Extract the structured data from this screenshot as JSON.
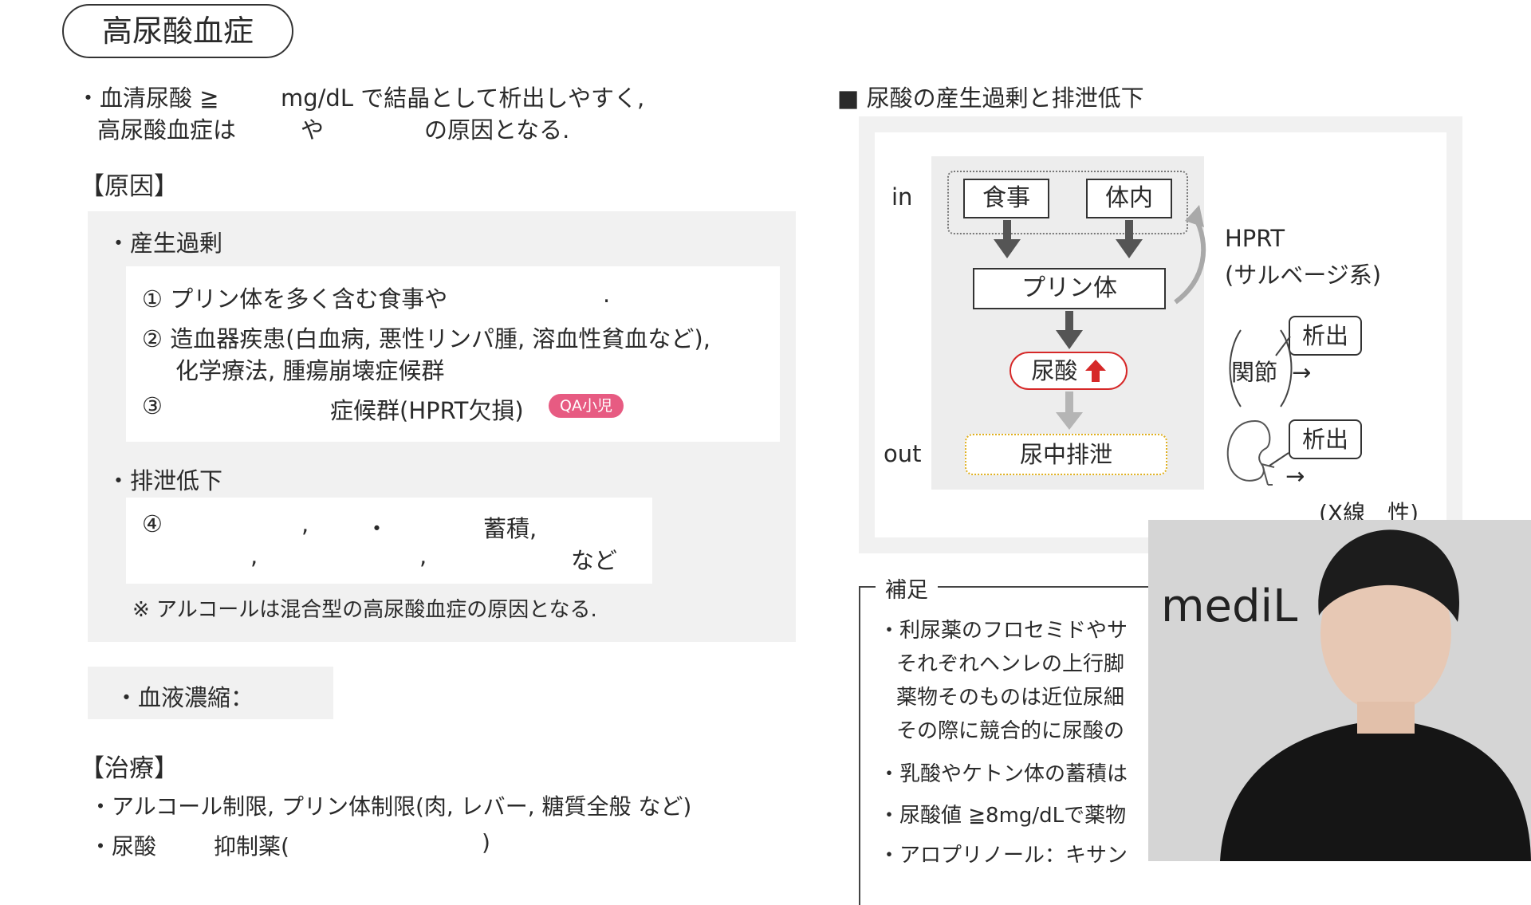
{
  "title": "高尿酸血症",
  "intro": {
    "line1": "・血清尿酸 ≧",
    "line1_unit": "mg/dL で結晶として析出しやすく,",
    "line2a": "高尿酸血症は",
    "line2b": "や",
    "line2c": "の原因となる."
  },
  "cause": {
    "heading": "【原因】",
    "overproduction": {
      "label": "・産生過剰",
      "item1": "① プリン体を多く含む食事や",
      "item1_end": ".",
      "item2_line1": "② 造血器疾患(白血病, 悪性リンパ腫, 溶血性貧血など),",
      "item2_line2": "化学療法, 腫瘍崩壊症候群",
      "item3_num": "③",
      "item3": "症候群(HPRT欠損)",
      "item3_badge": "QA小児"
    },
    "excretion": {
      "label": "・排泄低下",
      "item4_num": "④",
      "item4_c1": ",",
      "item4_dot": "・",
      "item4_acc": "蓄積,",
      "item4_c2": ",",
      "item4_c3": ",",
      "item4_etc": "など",
      "note": "※ アルコールは混合型の高尿酸血症の原因となる."
    },
    "concentration": "・血液濃縮："
  },
  "treatment": {
    "heading": "【治療】",
    "item1": "・アルコール制限, プリン体制限(肉, レバー, 糖質全般 など)",
    "item2a": "・尿酸",
    "item2b": "抑制薬(",
    "item2c": ")"
  },
  "diagram": {
    "heading": "■ 尿酸の産生過剰と排泄低下",
    "in_label": "in",
    "out_label": "out",
    "food": "食事",
    "body": "体内",
    "purine": "プリン体",
    "urate": "尿酸",
    "urine": "尿中排泄",
    "hprt_line1": "HPRT",
    "hprt_line2": "(サルベージ系)",
    "precip1": "析出",
    "joint": "関節",
    "arrow1": "→",
    "precip2": "析出",
    "arrow2": "→",
    "xray": "(X線　性)"
  },
  "supplement": {
    "label": "補足",
    "line1": "・利尿薬のフロセミドやサ",
    "line2": "それぞれヘンレの上行脚",
    "line3": "薬物そのものは近位尿細",
    "line4": "その際に競合的に尿酸の",
    "line5": "・乳酸やケトン体の蓄積は",
    "line6": "・尿酸値 ≧8mg/dLで薬物",
    "line7": "・アロプリノール：キサン"
  },
  "webcam": {
    "logo": "mediL"
  },
  "colors": {
    "accent_red": "#d62828",
    "badge_pink": "#e75b82",
    "panel_gray": "#f1f1f1",
    "dotted_yellow": "#e0b020"
  }
}
